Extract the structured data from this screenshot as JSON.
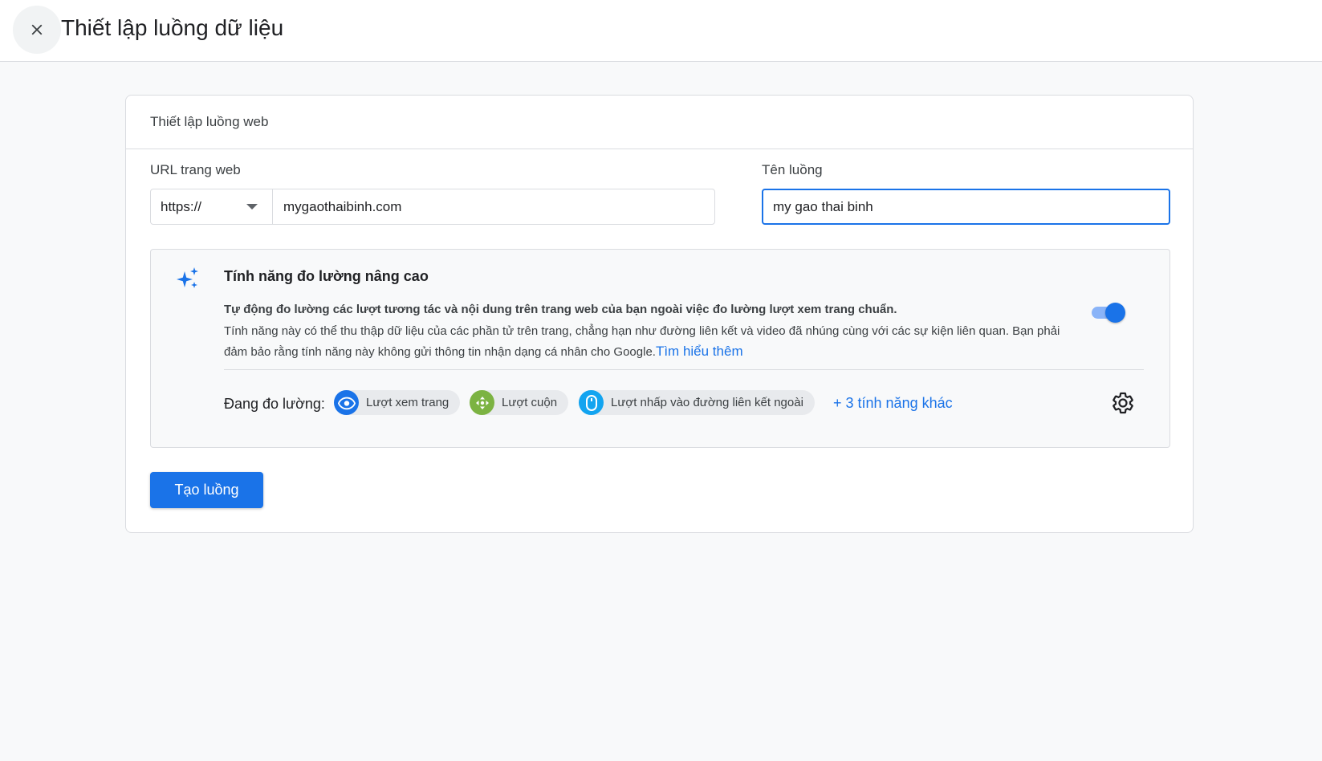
{
  "header": {
    "title": "Thiết lập luồng dữ liệu",
    "close_icon": "close-icon"
  },
  "card": {
    "title": "Thiết lập luồng web",
    "url_label": "URL trang web",
    "protocol": "https://",
    "url_value": "mygaothaibinh.com",
    "stream_name_label": "Tên luồng",
    "stream_name_value": "my gao thai binh"
  },
  "enhanced": {
    "title": "Tính năng đo lường nâng cao",
    "desc_bold": "Tự động đo lường các lượt tương tác và nội dung trên trang web của bạn ngoài việc đo lường lượt xem trang chuẩn.",
    "desc": "Tính năng này có thể thu thập dữ liệu của các phần tử trên trang, chẳng hạn như đường liên kết và video đã nhúng cùng với các sự kiện liên quan. Bạn phải đảm bảo rằng tính năng này không gửi thông tin nhận dạng cá nhân cho Google.",
    "learn_more": "Tìm hiểu thêm",
    "toggle_on": true,
    "measuring_label": "Đang đo lường:",
    "chips": [
      {
        "label": "Lượt xem trang",
        "icon": "eye-icon",
        "color": "#1a73e8"
      },
      {
        "label": "Lượt cuộn",
        "icon": "scroll-icon",
        "color": "#7cb342"
      },
      {
        "label": "Lượt nhấp vào đường liên kết ngoài",
        "icon": "mouse-icon",
        "color": "#12a4f0"
      }
    ],
    "more_features": "+ 3 tính năng khác",
    "settings_icon": "gear-icon"
  },
  "actions": {
    "create_label": "Tạo luồng"
  },
  "colors": {
    "accent": "#1a73e8",
    "toggle_track": "#8ab4f8"
  }
}
